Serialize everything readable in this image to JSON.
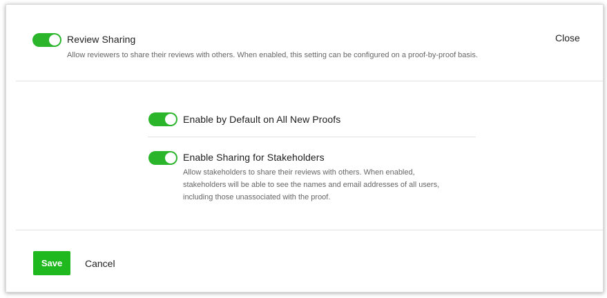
{
  "header": {
    "review_sharing": {
      "label": "Review Sharing",
      "enabled": true,
      "description": "Allow reviewers to share their reviews with others. When enabled, this setting can be configured on a proof-by-proof basis."
    },
    "close_label": "Close"
  },
  "options": [
    {
      "label": "Enable by Default on All New Proofs",
      "enabled": true
    },
    {
      "label": "Enable Sharing for Stakeholders",
      "enabled": true,
      "description_lines": [
        "Allow stakeholders to share their reviews with others. When enabled,",
        "stakeholders will be able to see the names and email addresses of all users,",
        "including those unassociated with the proof."
      ]
    }
  ],
  "footer": {
    "save_label": "Save",
    "cancel_label": "Cancel"
  },
  "colors": {
    "toggle_on": "#2bb52b",
    "save_button": "#1fb91f"
  }
}
